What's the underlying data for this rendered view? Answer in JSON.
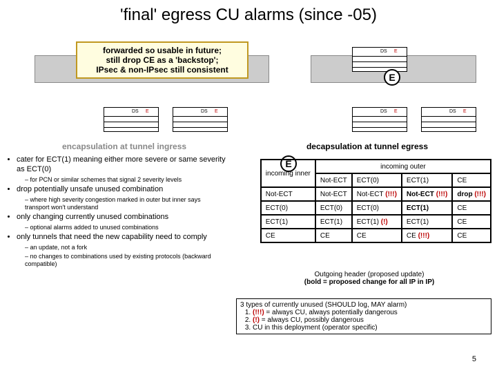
{
  "title": "'final' egress CU alarms (since -05)",
  "callout": {
    "l1": "forwarded so usable in future;",
    "l2": "still drop CE as a 'backstop';",
    "l3": "IPsec & non-IPsec still consistent"
  },
  "e_label": "E",
  "ds_label": "DS",
  "ecn_label": "E",
  "cap_left": "encapsulation at tunnel ingress",
  "cap_right": "decapsulation at tunnel egress",
  "bullets": [
    {
      "text": "cater for ECT(1) meaning either more severe or same severity as ECT(0)",
      "sub": [
        "for PCN or similar schemes that signal 2 severity levels"
      ]
    },
    {
      "text": "drop potentially unsafe unused combination",
      "sub": [
        "where high severity congestion marked in outer but inner says transport won't understand"
      ]
    },
    {
      "text": "only changing currently unused combinations",
      "sub": [
        "optional alarms added to unused combinations"
      ]
    },
    {
      "text": "only tunnels that need the new capability need to comply",
      "sub": [
        "an update, not a fork",
        "no changes to combinations used by existing protocols (backward compatible)"
      ]
    }
  ],
  "matrix": {
    "row_label": "incoming inner",
    "col_label": "incoming outer",
    "cols": [
      "Not-ECT",
      "ECT(0)",
      "ECT(1)",
      "CE"
    ],
    "rows": [
      {
        "h": "Not-ECT",
        "c": [
          "Not-ECT",
          "Not-ECT (!!!)",
          "Not-ECT (!!!)",
          "drop (!!!)"
        ],
        "bold": [
          0,
          0,
          1,
          1
        ],
        "red": [
          0,
          1,
          1,
          1
        ]
      },
      {
        "h": "ECT(0)",
        "c": [
          "ECT(0)",
          "ECT(0)",
          "ECT(1)",
          "CE"
        ],
        "bold": [
          0,
          0,
          1,
          0
        ],
        "red": [
          0,
          0,
          0,
          0
        ]
      },
      {
        "h": "ECT(1)",
        "c": [
          "ECT(1)",
          "ECT(1)    (!)",
          "ECT(1)",
          "CE"
        ],
        "bold": [
          0,
          0,
          0,
          0
        ],
        "red": [
          0,
          1,
          0,
          0
        ]
      },
      {
        "h": "CE",
        "c": [
          "CE",
          "CE",
          "CE (!!!)",
          "CE"
        ],
        "bold": [
          0,
          0,
          0,
          0
        ],
        "red": [
          0,
          0,
          1,
          0
        ]
      }
    ]
  },
  "out_caption": {
    "l1": "Outgoing header (proposed update)",
    "l2": "(bold = proposed change for all IP in IP)"
  },
  "types": {
    "header": "3 types of currently unused (SHOULD log, MAY alarm)",
    "items": [
      "(!!!) =  always CU, always potentially dangerous",
      "(!) =  always CU, possibly dangerous",
      "         CU in this deployment (operator specific)"
    ]
  },
  "pagenum": "5",
  "chart_data": {
    "type": "table",
    "title": "decapsulation at tunnel egress — outgoing header",
    "row_dimension": "incoming inner",
    "col_dimension": "incoming outer",
    "columns": [
      "Not-ECT",
      "ECT(0)",
      "ECT(1)",
      "CE"
    ],
    "rows": [
      "Not-ECT",
      "ECT(0)",
      "ECT(1)",
      "CE"
    ],
    "cells": [
      [
        "Not-ECT",
        "Not-ECT (!!!)",
        "Not-ECT (!!!)",
        "drop (!!!)"
      ],
      [
        "ECT(0)",
        "ECT(0)",
        "ECT(1)",
        "CE"
      ],
      [
        "ECT(1)",
        "ECT(1) (!)",
        "ECT(1)",
        "CE"
      ],
      [
        "CE",
        "CE",
        "CE (!!!)",
        "CE"
      ]
    ],
    "legend": {
      "(!!!)": "always CU, always potentially dangerous",
      "(!)": "always CU, possibly dangerous",
      "bold": "proposed change for all IP in IP"
    }
  }
}
